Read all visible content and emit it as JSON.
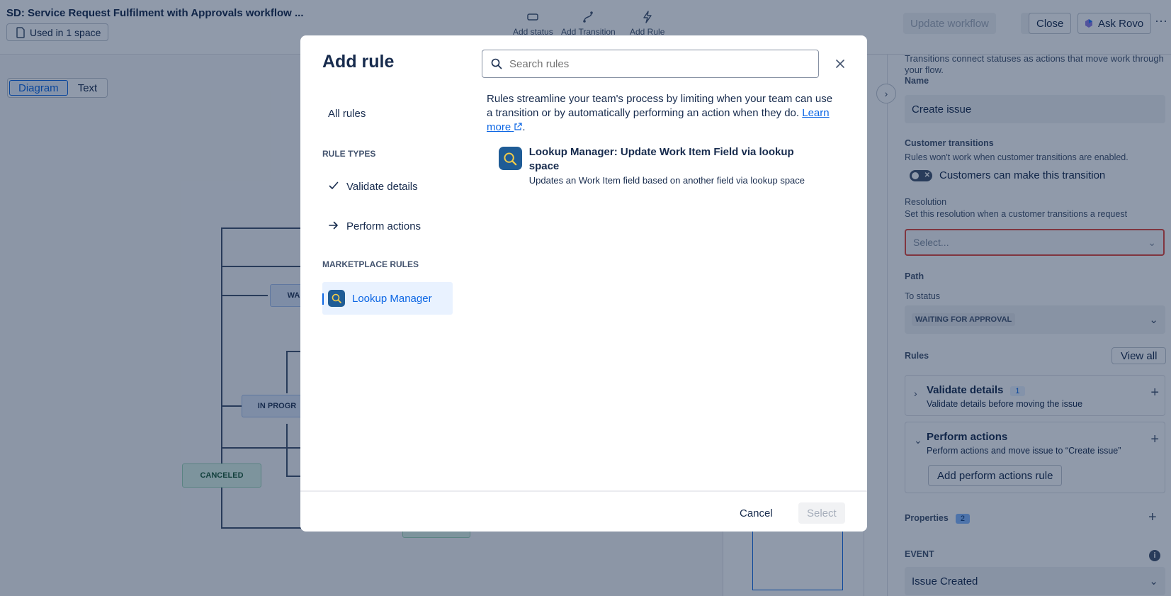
{
  "header": {
    "title": "SD: Service Request Fulfilment with Approvals workflow ...",
    "used_in": "Used in 1 space",
    "tools": [
      {
        "label": "Add status",
        "icon": "status-icon"
      },
      {
        "label": "Add Transition",
        "icon": "transition-icon"
      },
      {
        "label": "Add Rule",
        "icon": "lightning-icon"
      }
    ],
    "update_label": "Update workflow",
    "close_label": "Close",
    "rovo_label": "Ask Rovo"
  },
  "view_toggle": {
    "diagram": "Diagram",
    "text": "Text"
  },
  "canvas": {
    "nodes": {
      "waiting": "WAI",
      "in_progress": "IN PROGR",
      "canceled": "CANCELED"
    }
  },
  "panel": {
    "intro_line1": "Transitions connect statuses as actions that move work through",
    "intro_line2": "your flow.",
    "name_label": "Name",
    "name_value": "Create issue",
    "customer_transitions_label": "Customer transitions",
    "customer_transitions_help": "Rules won't work when customer transitions are enabled.",
    "customer_toggle_label": "Customers can make this transition",
    "resolution_label": "Resolution",
    "resolution_help": "Set this resolution when a customer transitions a request",
    "resolution_placeholder": "Select...",
    "path_label": "Path",
    "to_status_label": "To status",
    "to_status_value": "WAITING FOR APPROVAL",
    "rules_label": "Rules",
    "view_all_label": "View all",
    "validate": {
      "title": "Validate details",
      "count": "1",
      "desc": "Validate details before moving the issue"
    },
    "perform": {
      "title": "Perform actions",
      "desc": "Perform actions and move issue to “Create issue”",
      "add_label": "Add perform actions rule"
    },
    "properties_label": "Properties",
    "properties_count": "2",
    "event_label": "EVENT",
    "event_value": "Issue Created"
  },
  "modal": {
    "title": "Add rule",
    "search_placeholder": "Search rules",
    "nav": {
      "all_rules": "All rules",
      "rule_types_heading": "RULE TYPES",
      "validate_details": "Validate details",
      "perform_actions": "Perform actions",
      "marketplace_heading": "MARKETPLACE RULES",
      "lookup_manager": "Lookup Manager"
    },
    "intro_text": "Rules streamline your team's process by limiting when your team can use a transition or by automatically performing an action when they do.",
    "learn_more": "Learn more",
    "result": {
      "title": "Lookup Manager: Update Work Item Field via lookup space",
      "desc": "Updates an Work Item field based on another field via lookup space"
    },
    "cancel_label": "Cancel",
    "select_label": "Select"
  },
  "colors": {
    "accent": "#0c66e4",
    "error": "#e2483d",
    "overlay": "rgba(9,30,66,0.45)"
  }
}
